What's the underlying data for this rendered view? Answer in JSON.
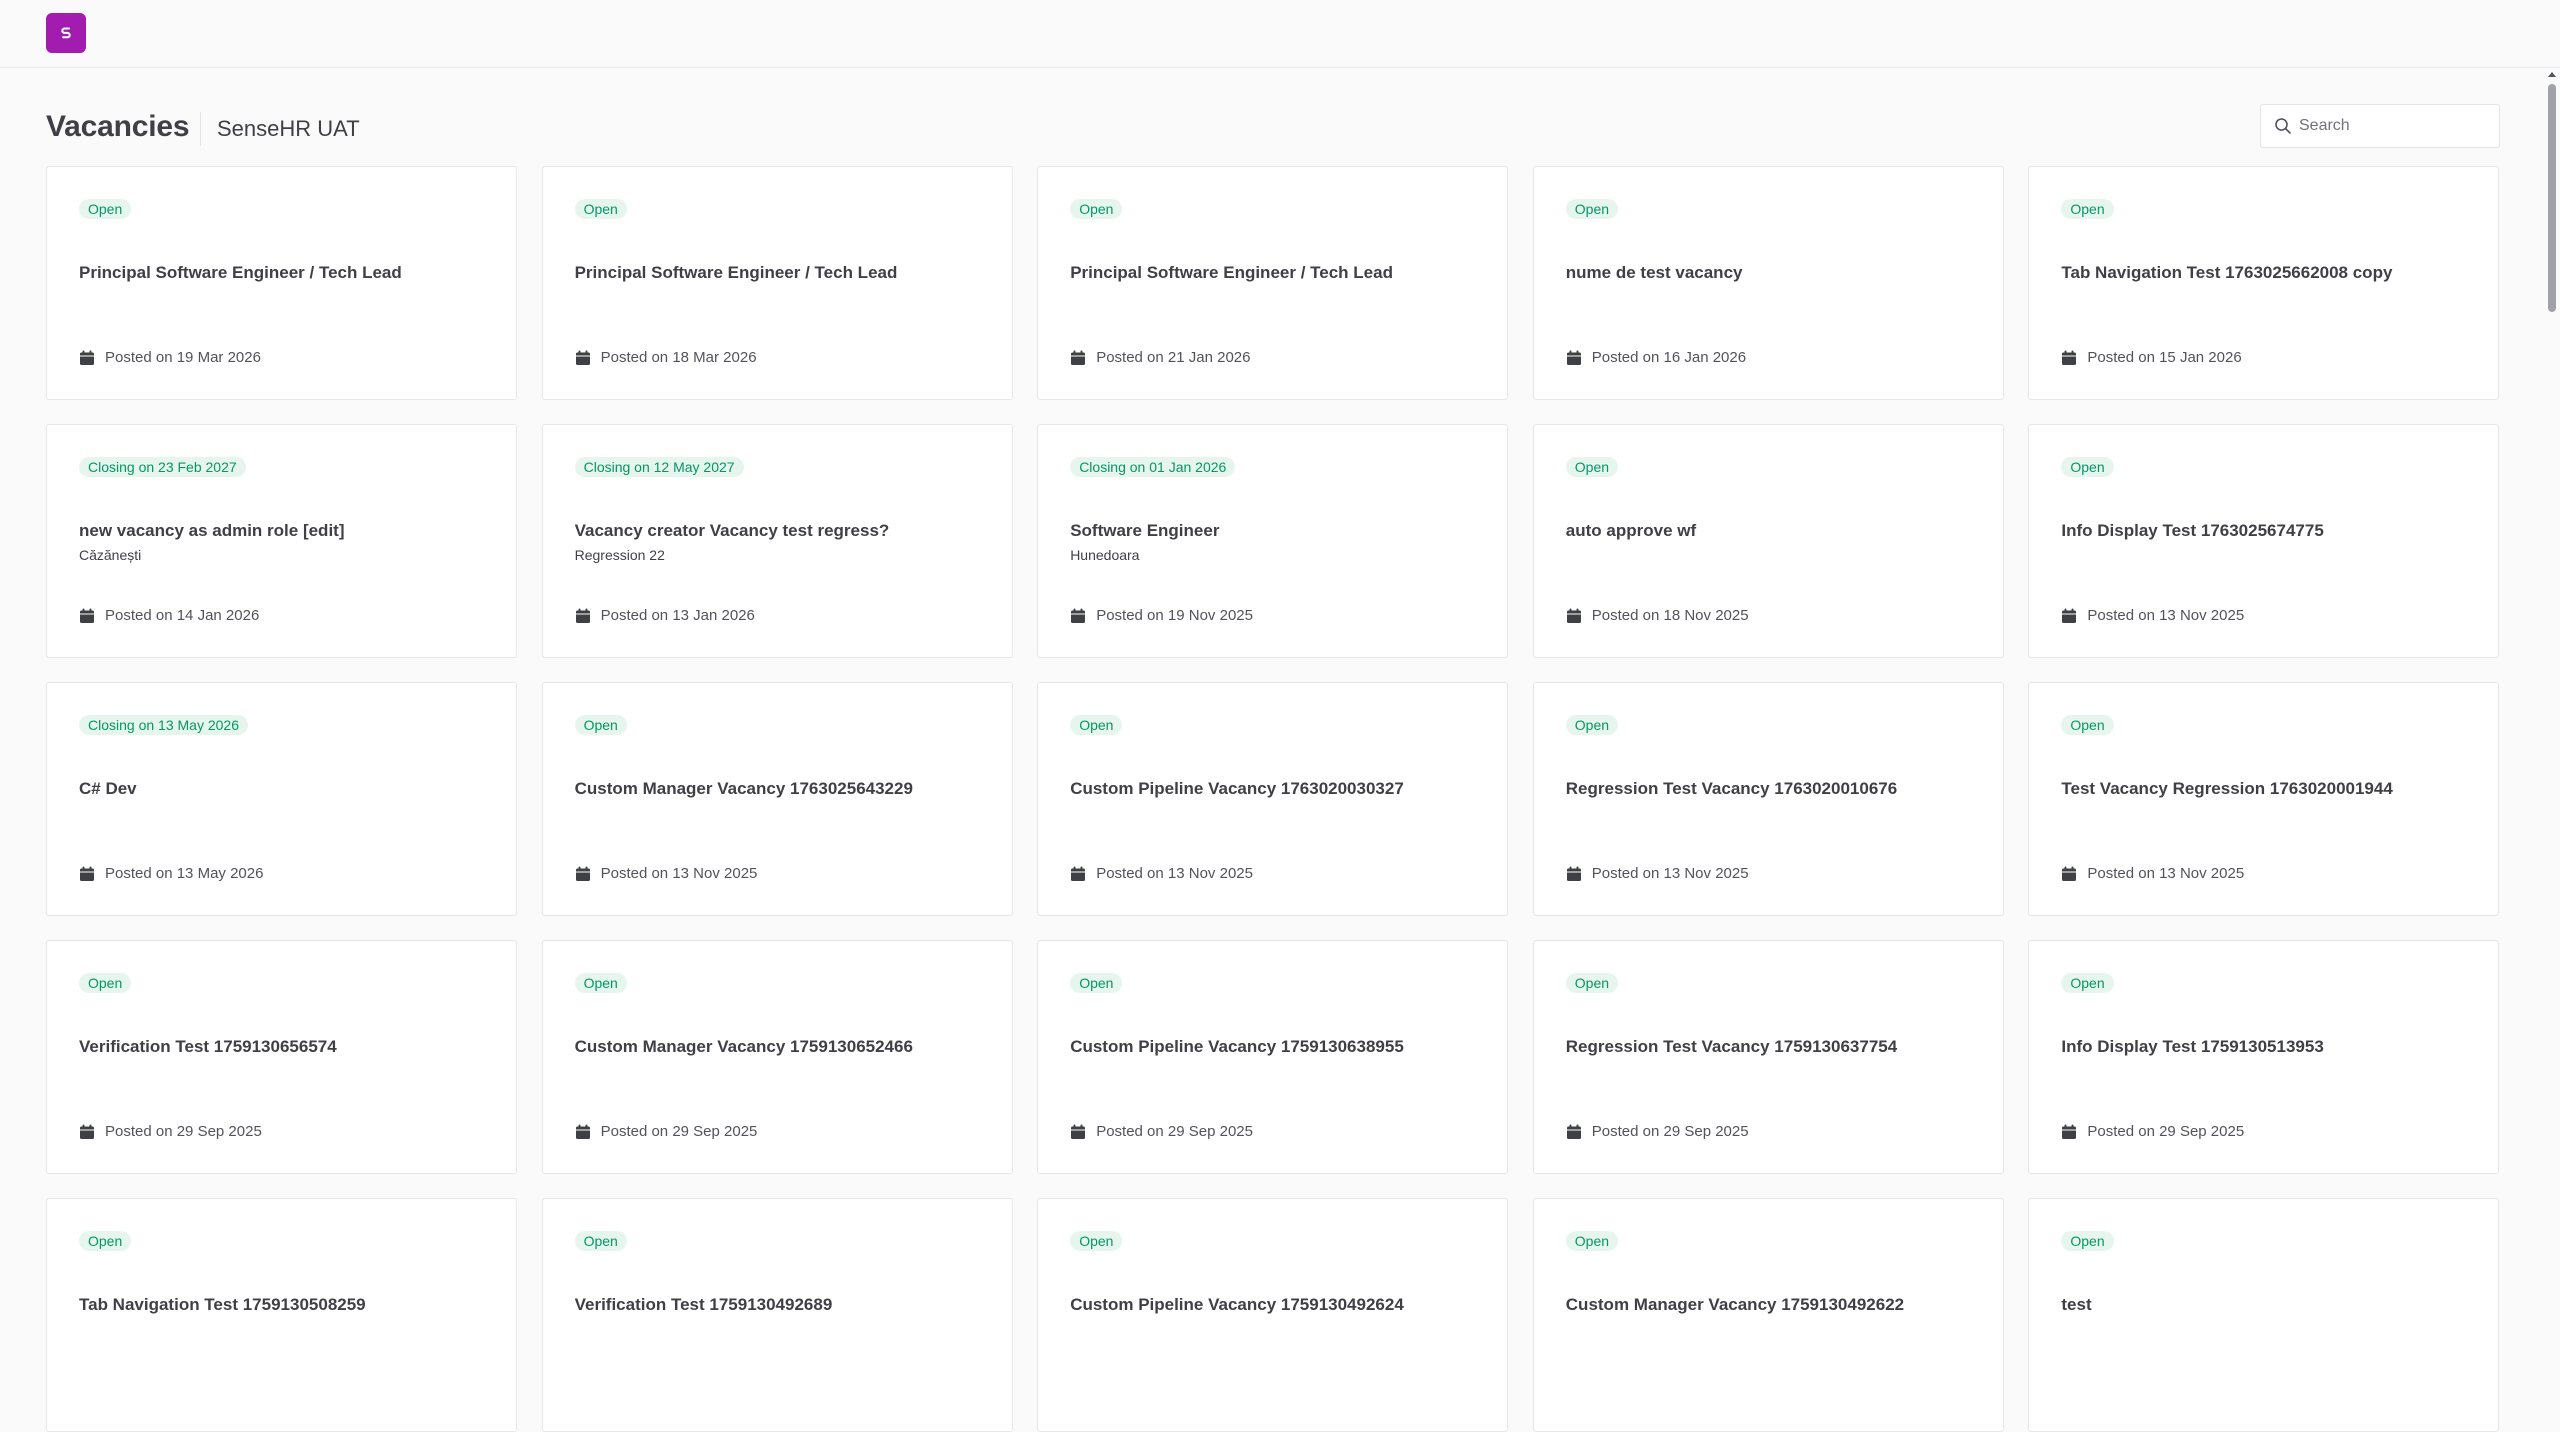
{
  "header": {
    "title": "Vacancies",
    "org": "SenseHR UAT",
    "search_placeholder": "Search"
  },
  "colors": {
    "brand": "#a21caf",
    "badge_bg": "#e6f6ee",
    "badge_text": "#059669"
  },
  "vacancies": [
    {
      "status": "Open",
      "title": "Principal Software Engineer / Tech Lead",
      "location": "",
      "posted": "Posted on 19 Mar 2026"
    },
    {
      "status": "Open",
      "title": "Principal Software Engineer / Tech Lead",
      "location": "",
      "posted": "Posted on 18 Mar 2026"
    },
    {
      "status": "Open",
      "title": "Principal Software Engineer / Tech Lead",
      "location": "",
      "posted": "Posted on 21 Jan 2026"
    },
    {
      "status": "Open",
      "title": "nume de test vacancy",
      "location": "",
      "posted": "Posted on 16 Jan 2026"
    },
    {
      "status": "Open",
      "title": "Tab Navigation Test 1763025662008 copy",
      "location": "",
      "posted": "Posted on 15 Jan 2026"
    },
    {
      "status": "Closing on 23 Feb 2027",
      "title": "new vacancy as admin role [edit]",
      "location": "Căzănești",
      "posted": "Posted on 14 Jan 2026"
    },
    {
      "status": "Closing on 12 May 2027",
      "title": "Vacancy creator Vacancy test regress?",
      "location": "Regression 22",
      "posted": "Posted on 13 Jan 2026"
    },
    {
      "status": "Closing on 01 Jan 2026",
      "title": "Software Engineer",
      "location": "Hunedoara",
      "posted": "Posted on 19 Nov 2025"
    },
    {
      "status": "Open",
      "title": "auto approve wf",
      "location": "",
      "posted": "Posted on 18 Nov 2025"
    },
    {
      "status": "Open",
      "title": "Info Display Test 1763025674775",
      "location": "",
      "posted": "Posted on 13 Nov 2025"
    },
    {
      "status": "Closing on 13 May 2026",
      "title": "C# Dev",
      "location": "",
      "posted": "Posted on 13 May 2026"
    },
    {
      "status": "Open",
      "title": "Custom Manager Vacancy 1763025643229",
      "location": "",
      "posted": "Posted on 13 Nov 2025"
    },
    {
      "status": "Open",
      "title": "Custom Pipeline Vacancy 1763020030327",
      "location": "",
      "posted": "Posted on 13 Nov 2025"
    },
    {
      "status": "Open",
      "title": "Regression Test Vacancy 1763020010676",
      "location": "",
      "posted": "Posted on 13 Nov 2025"
    },
    {
      "status": "Open",
      "title": "Test Vacancy Regression 1763020001944",
      "location": "",
      "posted": "Posted on 13 Nov 2025"
    },
    {
      "status": "Open",
      "title": "Verification Test 1759130656574",
      "location": "",
      "posted": "Posted on 29 Sep 2025"
    },
    {
      "status": "Open",
      "title": "Custom Manager Vacancy 1759130652466",
      "location": "",
      "posted": "Posted on 29 Sep 2025"
    },
    {
      "status": "Open",
      "title": "Custom Pipeline Vacancy 1759130638955",
      "location": "",
      "posted": "Posted on 29 Sep 2025"
    },
    {
      "status": "Open",
      "title": "Regression Test Vacancy 1759130637754",
      "location": "",
      "posted": "Posted on 29 Sep 2025"
    },
    {
      "status": "Open",
      "title": "Info Display Test 1759130513953",
      "location": "",
      "posted": "Posted on 29 Sep 2025"
    },
    {
      "status": "Open",
      "title": "Tab Navigation Test 1759130508259",
      "location": "",
      "posted": ""
    },
    {
      "status": "Open",
      "title": "Verification Test 1759130492689",
      "location": "",
      "posted": ""
    },
    {
      "status": "Open",
      "title": "Custom Pipeline Vacancy 1759130492624",
      "location": "",
      "posted": ""
    },
    {
      "status": "Open",
      "title": "Custom Manager Vacancy 1759130492622",
      "location": "",
      "posted": ""
    },
    {
      "status": "Open",
      "title": "test",
      "location": "",
      "posted": ""
    }
  ]
}
